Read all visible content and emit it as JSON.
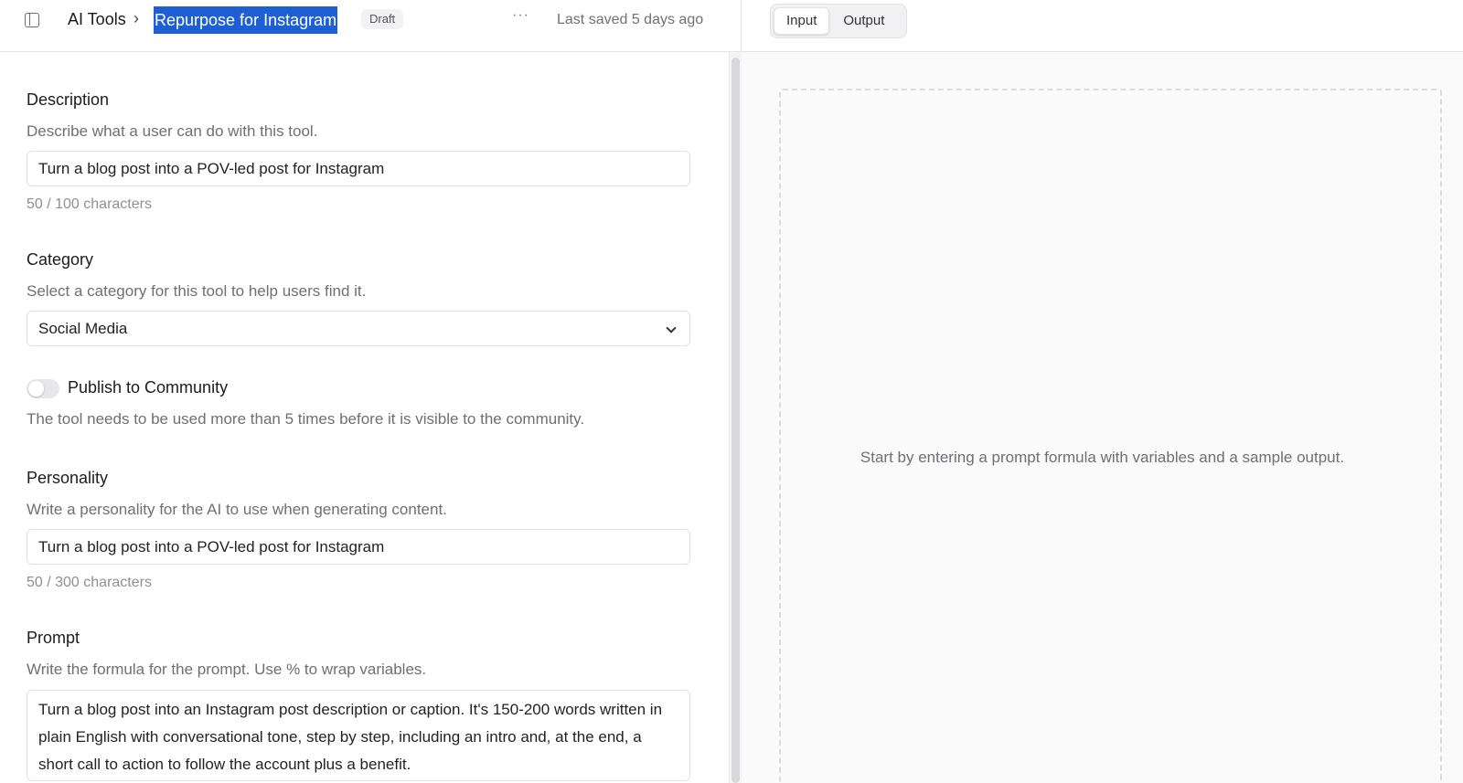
{
  "header": {
    "breadcrumb_root": "AI Tools",
    "breadcrumb_separator": "›",
    "tool_name": "Repurpose for Instagram",
    "status_badge": "Draft",
    "more_label": "···",
    "last_saved": "Last saved 5 days ago"
  },
  "preview_tabs": [
    {
      "label": "Input",
      "active": true
    },
    {
      "label": "Output",
      "active": false
    }
  ],
  "form": {
    "description": {
      "label": "Description",
      "help": "Describe what a user can do with this tool.",
      "value": "Turn a blog post into a POV-led post for Instagram",
      "counter": "50 / 100 characters"
    },
    "category": {
      "label": "Category",
      "help": "Select a category for this tool to help users find it.",
      "selected": "Social Media"
    },
    "publish": {
      "label": "Publish to Community",
      "enabled": false,
      "help": "The tool needs to be used more than 5 times before it is visible to the community."
    },
    "personality": {
      "label": "Personality",
      "help": "Write a personality for the AI to use when generating content.",
      "value": "Turn a blog post into a POV-led post for Instagram",
      "counter": "50 / 300 characters"
    },
    "prompt": {
      "label": "Prompt",
      "help": "Write the formula for the prompt. Use % to wrap variables.",
      "value": "Turn a blog post into an Instagram post description or caption. It's 150-200 words written in plain English with conversational tone, step by step, including an intro and, at the end, a short call to action to follow the account plus a benefit."
    }
  },
  "preview": {
    "empty_message": "Start by entering a prompt formula with variables and a sample output."
  },
  "colors": {
    "selection_highlight": "#1f5fd6",
    "border": "#e1e1e4",
    "muted_text": "#6f6f74",
    "preview_background": "#fafafa"
  }
}
